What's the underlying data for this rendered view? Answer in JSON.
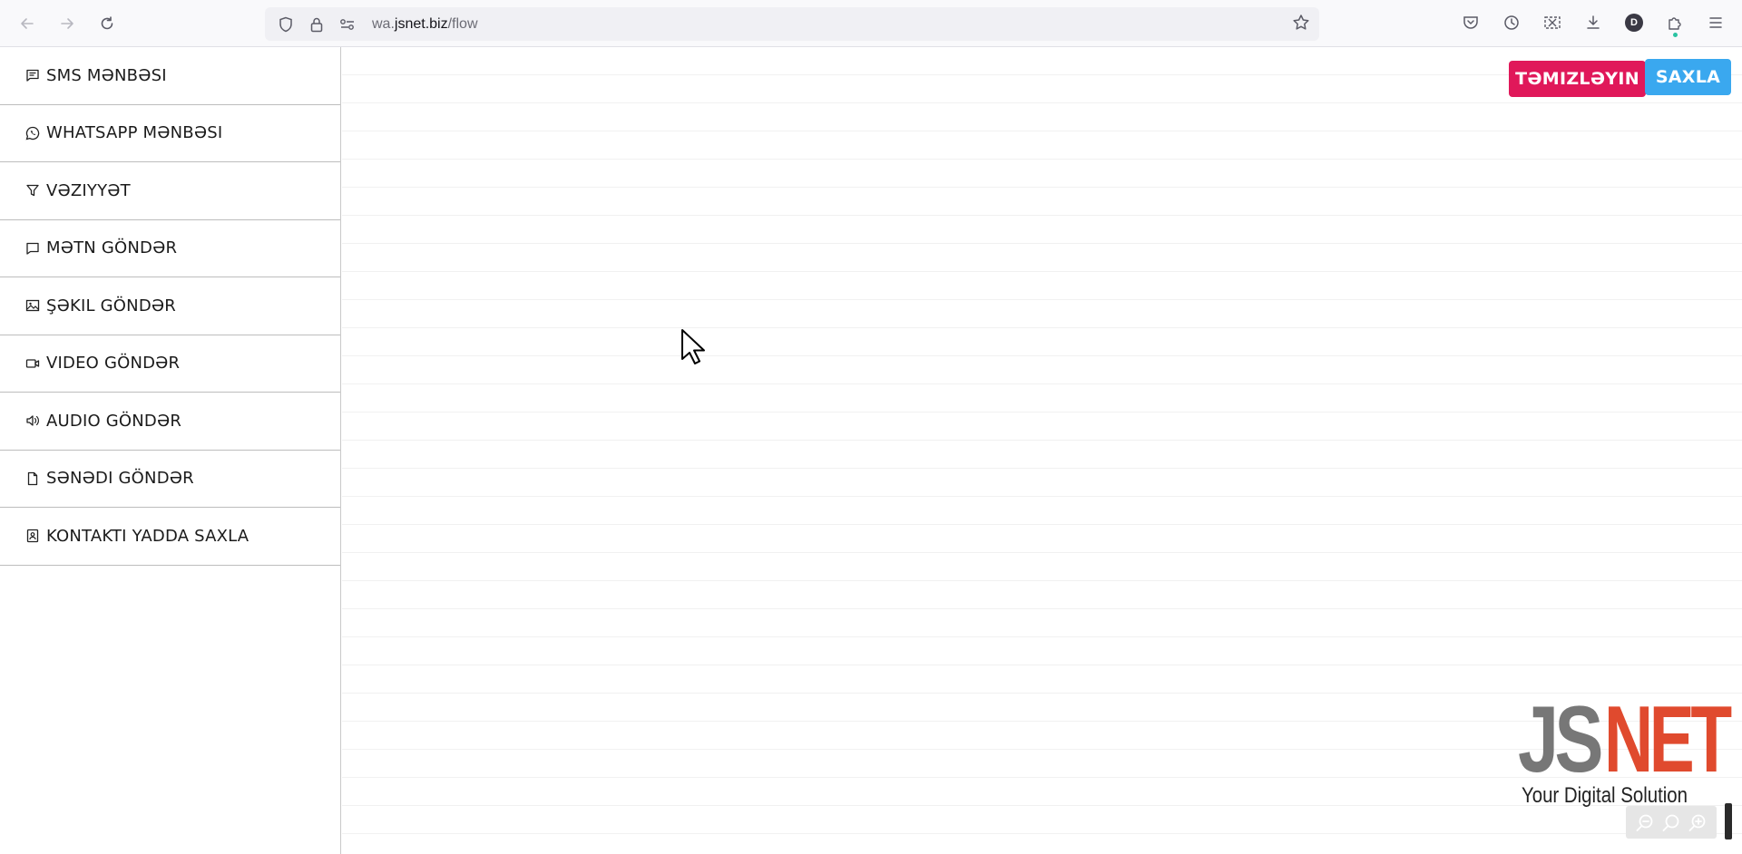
{
  "browser": {
    "url_prefix": "wa.",
    "url_domain": "jsnet.biz",
    "url_path": "/flow",
    "profile_initial": "D"
  },
  "sidebar": {
    "items": [
      {
        "label": "SMS MƏNBƏSI",
        "icon": "message-square-icon"
      },
      {
        "label": "WHATSAPP MƏNBƏSI",
        "icon": "whatsapp-icon"
      },
      {
        "label": "VƏZIYYƏT",
        "icon": "filter-icon"
      },
      {
        "label": "MƏTN GÖNDƏR",
        "icon": "chat-bubble-icon"
      },
      {
        "label": "ŞƏKIL GÖNDƏR",
        "icon": "image-icon"
      },
      {
        "label": "VIDEO GÖNDƏR",
        "icon": "video-camera-icon"
      },
      {
        "label": "AUDIO GÖNDƏR",
        "icon": "speaker-icon"
      },
      {
        "label": "SƏNƏDI GÖNDƏR",
        "icon": "document-icon"
      },
      {
        "label": "KONTAKTI YADDA SAXLA",
        "icon": "contact-card-icon"
      }
    ]
  },
  "toolbar": {
    "clear_label": "TƏMIZLƏYIN",
    "save_label": "SAXLA",
    "clear_color": "#e0185a",
    "save_color": "#3aa8ef"
  },
  "logo": {
    "js": "JS",
    "net": "NET",
    "tagline": "Your Digital Solution"
  }
}
